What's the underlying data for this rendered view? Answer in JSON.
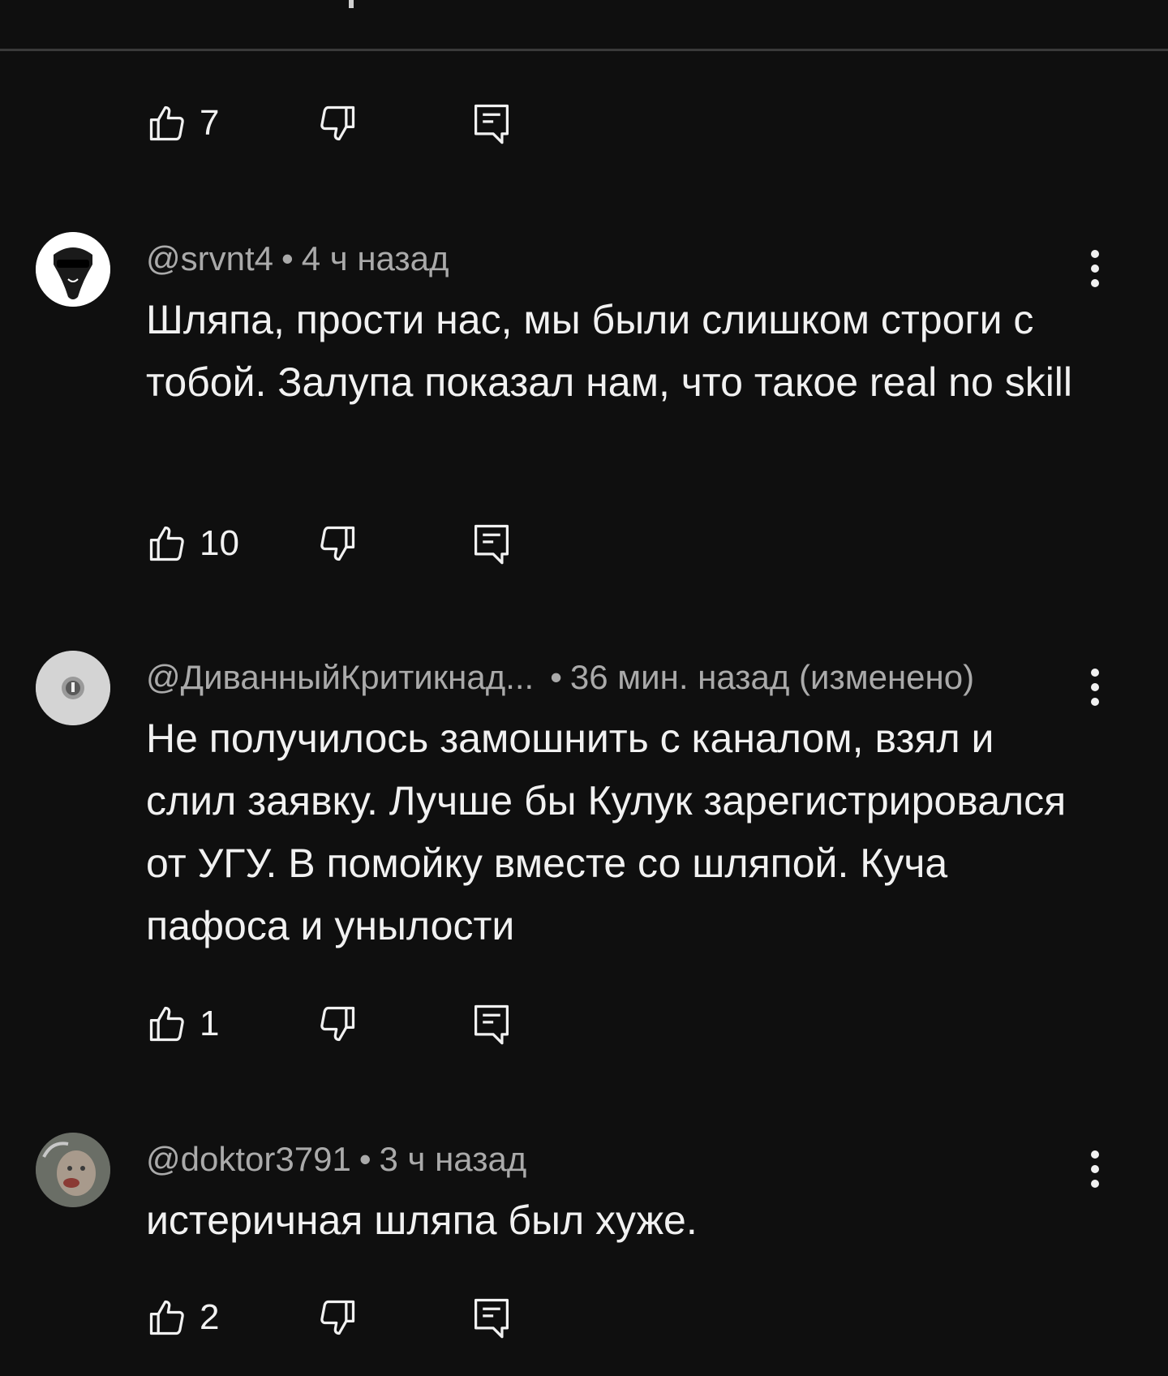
{
  "top_actions": {
    "likes": "7"
  },
  "comments": [
    {
      "author": "@srvnt4",
      "separator": "•",
      "time": "4 ч назад",
      "text": "Шляпа, прости нас, мы были слишком строги с тобой. Залупа показал нам, что такое real no skill",
      "likes": "10"
    },
    {
      "author": "@ДиванныйКритикнад...",
      "separator": "•",
      "time": "36 мин. назад (изменено)",
      "text": "Не получилось замошнить  с каналом, взял и слил заявку. Лучше бы Кулук зарегистрировался от УГУ.  В помойку вместе со шляпой. Куча пафоса и унылости",
      "likes": "1"
    },
    {
      "author": "@doktor3791",
      "separator": "•",
      "time": "3 ч назад",
      "text": "истеричная шляпа был хуже.",
      "likes": "2"
    }
  ],
  "icons": {
    "like": "thumbs-up-icon",
    "dislike": "thumbs-down-icon",
    "reply": "reply-comment-icon",
    "more": "more-vertical-icon"
  },
  "colors": {
    "background": "#0f0f0f",
    "text": "#f1f1f1",
    "meta": "#aaaaaa"
  }
}
